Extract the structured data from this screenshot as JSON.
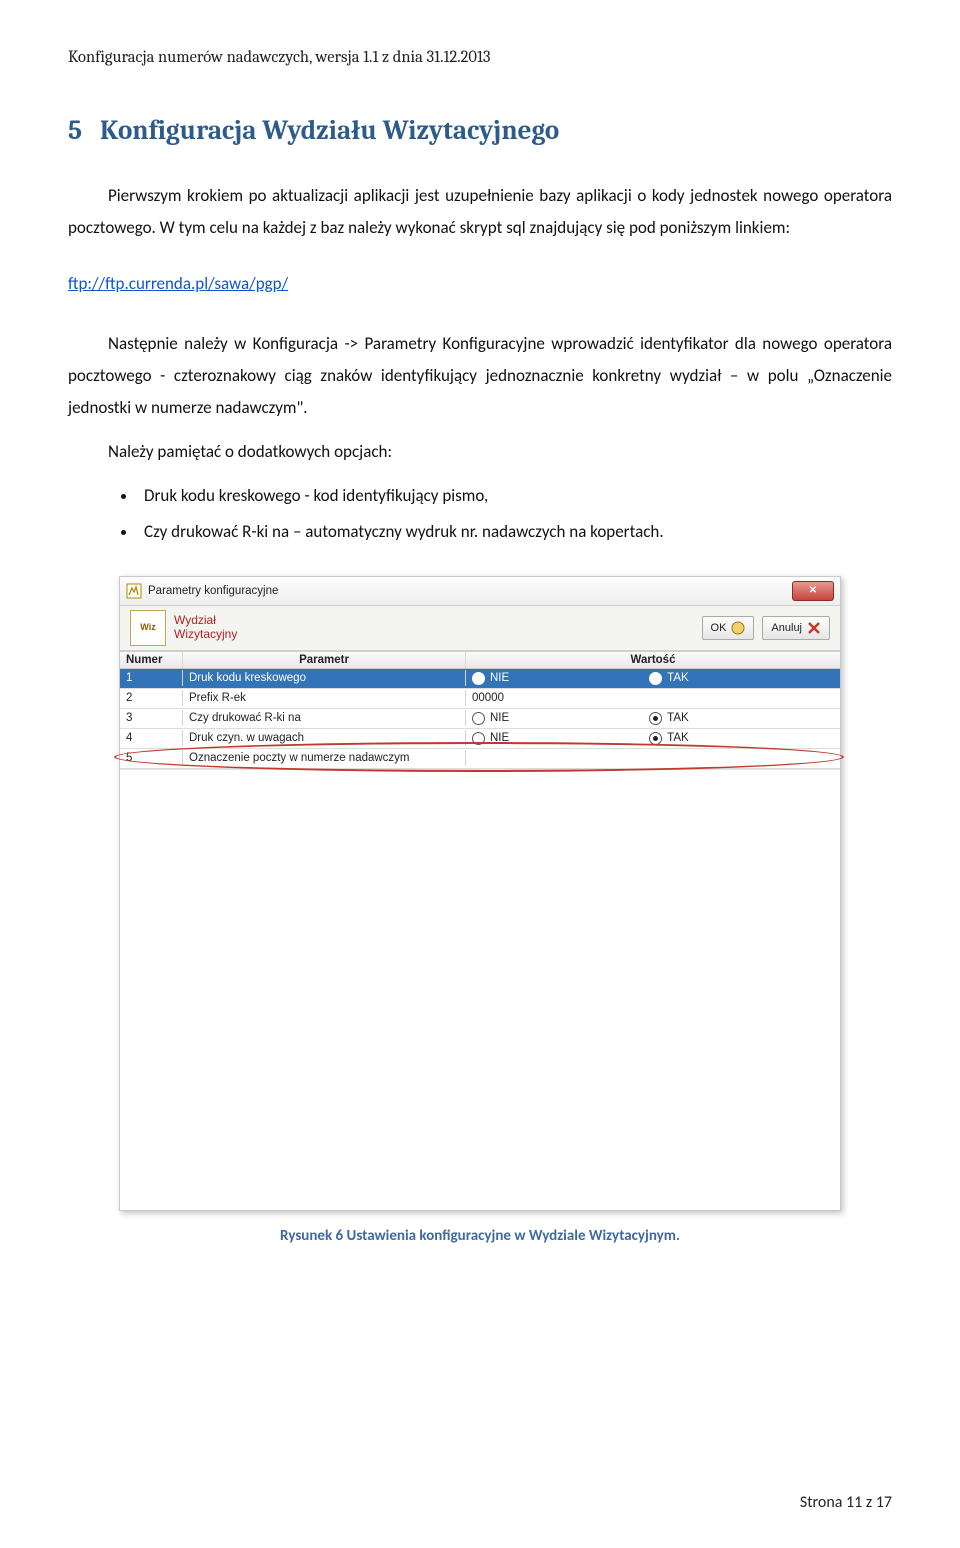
{
  "header": {
    "text": "Konfiguracja numerów nadawczych, wersja 1.1 z dnia 31.12.2013"
  },
  "section": {
    "number": "5",
    "title": "Konfiguracja Wydziału Wizytacyjnego"
  },
  "paragraphs": {
    "p1": "Pierwszym krokiem po aktualizacji aplikacji jest uzupełnienie bazy aplikacji o kody jednostek nowego operatora pocztowego. W tym celu na każdej z baz należy wykonać skrypt sql znajdujący się pod poniższym linkiem:",
    "link": "ftp://ftp.currenda.pl/sawa/pgp/",
    "p2": "Następnie należy w Konfiguracja -> Parametry Konfiguracyjne wprowadzić identyfikator dla nowego operatora pocztowego - czteroznakowy ciąg znaków identyfikujący jednoznacznie konkretny wydział – w polu „Oznaczenie jednostki w numerze nadawczym\".",
    "p3": "Należy pamiętać o dodatkowych opcjach:",
    "b1": "Druk kodu kreskowego - kod identyfikujący pismo,",
    "b2": "Czy  drukować R-ki na – automatyczny wydruk nr. nadawczych na kopertach."
  },
  "dialog": {
    "title": "Parametry konfiguracyjne",
    "module_line1": "Wydział",
    "module_line2": "Wizytacyjny",
    "wiz_logo": "Wiz",
    "ok_label": "OK",
    "cancel_label": "Anuluj",
    "columns": {
      "num": "Numer",
      "par": "Parametr",
      "val": "Wartość"
    },
    "rows": [
      {
        "num": "1",
        "par": "Druk kodu kreskowego",
        "nie": "NIE",
        "tak": "TAK",
        "value": "TAK",
        "type": "radio"
      },
      {
        "num": "2",
        "par": "Prefix R-ek",
        "text": "00000",
        "type": "text"
      },
      {
        "num": "3",
        "par": "Czy drukować R-ki na",
        "nie": "NIE",
        "tak": "TAK",
        "value": "TAK",
        "type": "radio"
      },
      {
        "num": "4",
        "par": "Druk czyn. w uwagach",
        "nie": "NIE",
        "tak": "TAK",
        "value": "TAK",
        "type": "radio"
      },
      {
        "num": "5",
        "par": "Oznaczenie poczty w numerze nadawczym",
        "text": "",
        "type": "text"
      }
    ]
  },
  "caption": "Rysunek 6 Ustawienia konfiguracyjne w Wydziale Wizytacyjnym.",
  "footer": "Strona 11 z 17"
}
